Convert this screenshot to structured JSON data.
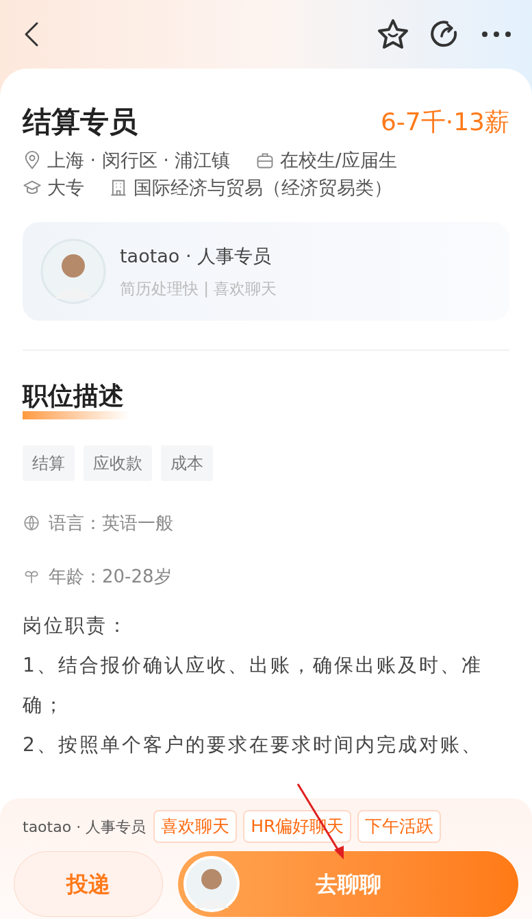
{
  "job": {
    "title": "结算专员",
    "salary": "6-7千·13薪",
    "details": [
      [
        {
          "kind": "location",
          "text": "上海 · 闵行区 · 浦江镇"
        },
        {
          "kind": "experience",
          "text": "在校生/应届生"
        }
      ],
      [
        {
          "kind": "education",
          "text": "大专"
        },
        {
          "kind": "major",
          "text": "国际经济与贸易（经济贸易类）"
        }
      ]
    ]
  },
  "recruiter": {
    "name": "taotao · 人事专员",
    "tagline": "简历处理快 | 喜欢聊天"
  },
  "description": {
    "heading": "职位描述",
    "tags": [
      "结算",
      "应收款",
      "成本"
    ],
    "requirements": [
      {
        "kind": "language",
        "text": "语言：英语一般"
      },
      {
        "kind": "age",
        "text": "年龄：20-28岁"
      }
    ],
    "duties": [
      "岗位职责：",
      "1、结合报价确认应收、出账，确保出账及时、准确；",
      "2、按照单个客户的要求在要求时间内完成对账、"
    ]
  },
  "footer": {
    "recruiter": "taotao · 人事专员",
    "badges": [
      "喜欢聊天",
      "HR偏好聊天",
      "下午活跃"
    ],
    "apply_button": "投递",
    "chat_button": "去聊聊"
  }
}
